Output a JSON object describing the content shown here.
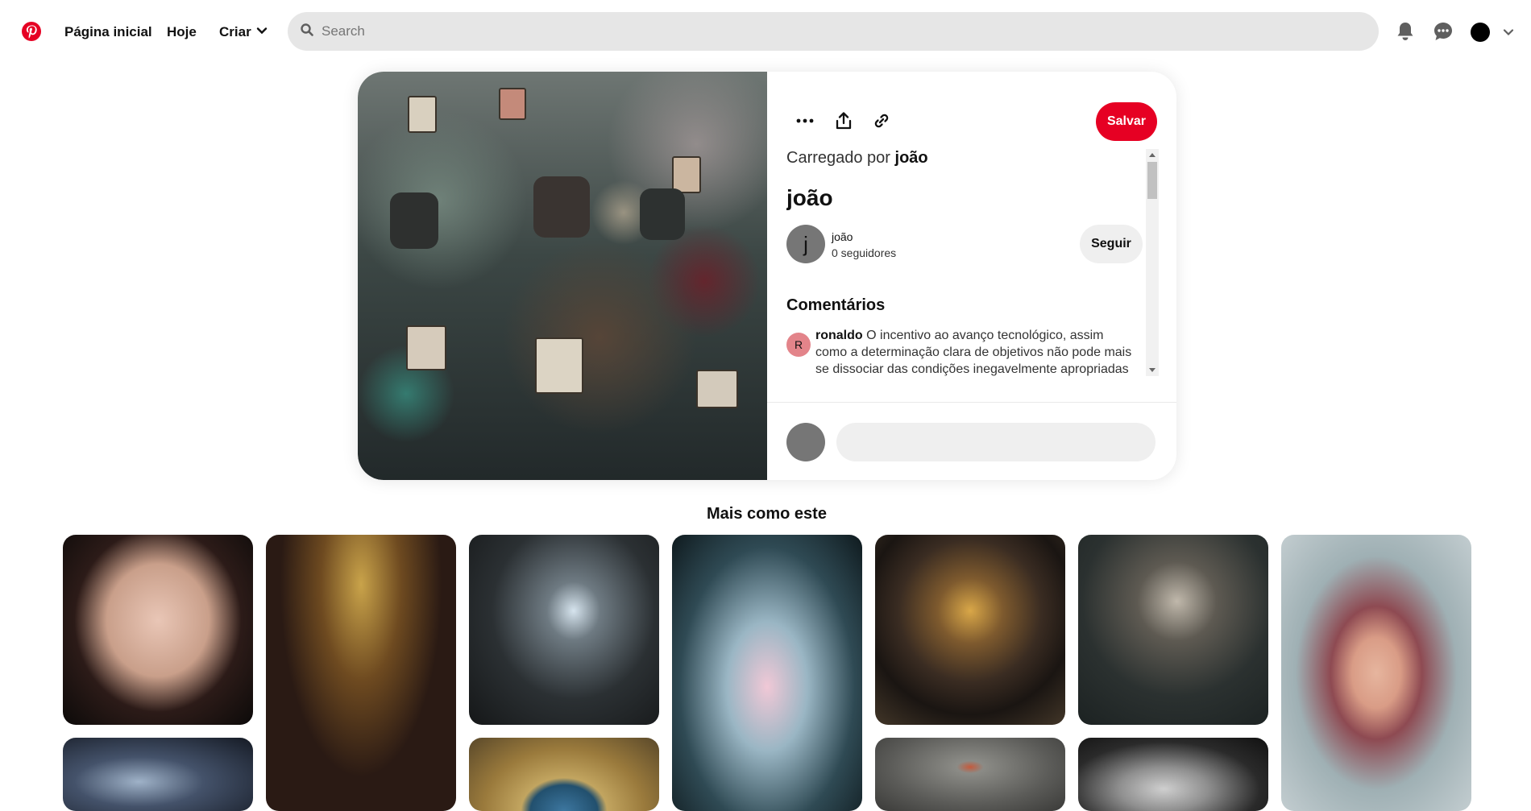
{
  "header": {
    "logo_icon": "pinterest-logo",
    "nav": {
      "home": "Página inicial",
      "today": "Hoje",
      "create": "Criar"
    },
    "search": {
      "placeholder": "Search"
    },
    "icons": [
      "bell-icon",
      "chat-icon",
      "avatar",
      "chevron-down-icon"
    ]
  },
  "pin": {
    "actions": {
      "more_icon": "more-icon",
      "share_icon": "share-icon",
      "link_icon": "link-icon"
    },
    "save_label": "Salvar",
    "uploaded_prefix": "Carregado por",
    "uploaded_by": "joão",
    "title": "joão",
    "creator": {
      "initial": "j",
      "name": "joão",
      "followers": "0 seguidores",
      "follow_label": "Seguir"
    },
    "comments_heading": "Comentários",
    "comments": [
      {
        "initial": "R",
        "user": "ronaldo",
        "text": "O incentivo ao avanço tecnológico, assim como a determinação clara de objetivos não pode mais se dissociar das condições inegavelmente apropriadas"
      }
    ]
  },
  "more_like_this": {
    "heading": "Mais como este"
  },
  "colors": {
    "brand_red": "#e60023",
    "search_bg": "#e6e6e6",
    "button_gray": "#efefef",
    "comment_avatar": "#e3848a"
  }
}
